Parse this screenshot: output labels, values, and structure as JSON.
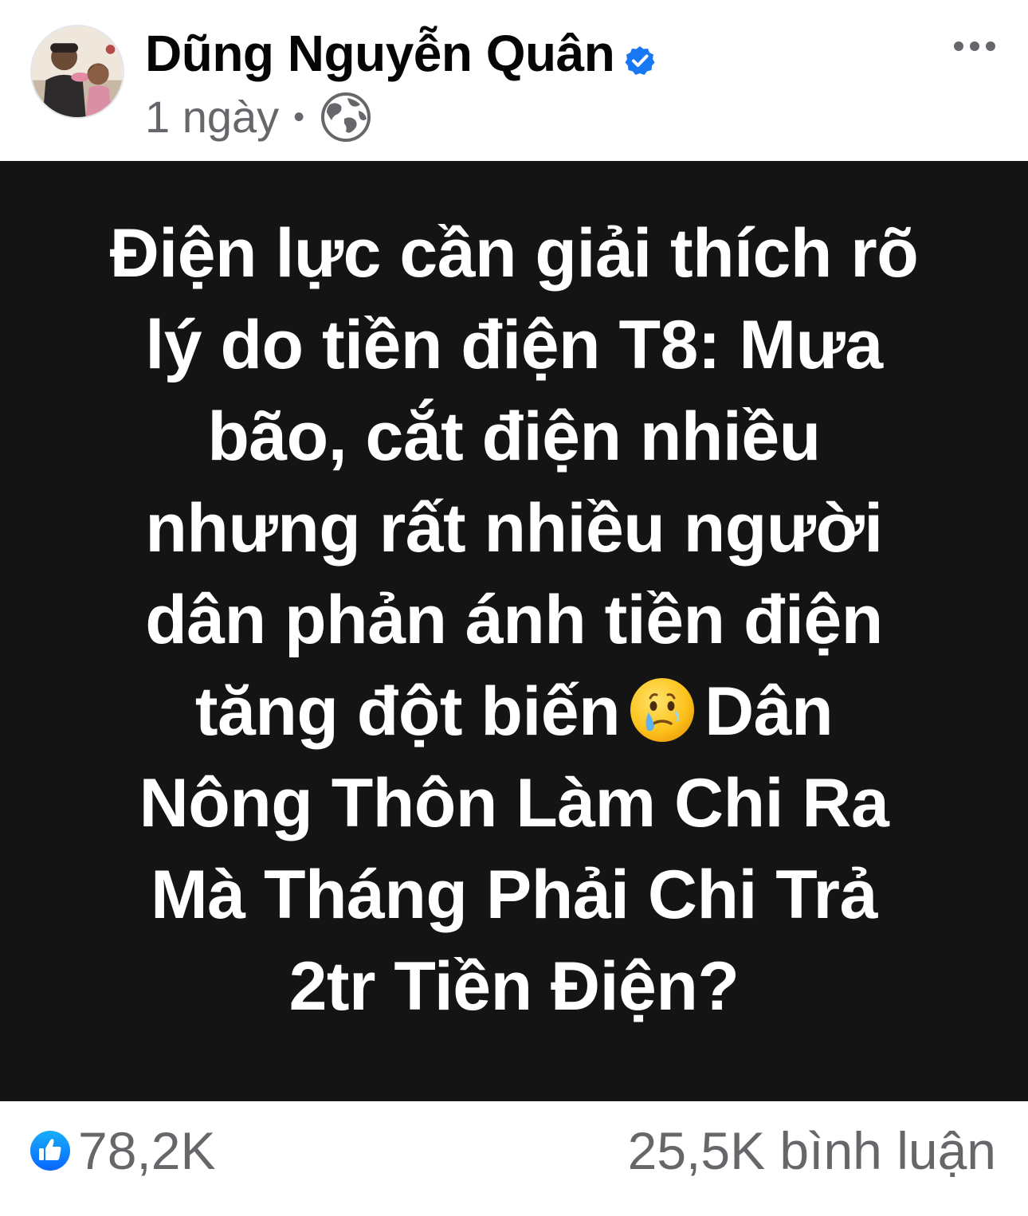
{
  "header": {
    "author_name": "Dũng Nguyễn Quân",
    "time_text": "1 ngày",
    "separator": "•",
    "audience_icon": "globe-icon",
    "verified_icon": "verified-badge-icon",
    "more_icon": "more-horizontal-icon"
  },
  "post": {
    "background_color": "#141414",
    "text_color": "#ffffff",
    "lines": [
      "Điện lực cần giải thích rõ",
      "lý do tiền điện T8: Mưa",
      "bão, cắt điện nhiều",
      "nhưng rất nhiều người",
      "dân phản ánh tiền điện",
      "tăng đột biến",
      "Dân",
      "Nông Thôn Làm Chi Ra",
      "Mà Tháng Phải Chi Trả",
      "2tr Tiền Điện?"
    ],
    "emoji": "face-holding-back-tears-emoji"
  },
  "footer": {
    "reaction_icon": "like-icon",
    "reaction_count": "78,2K",
    "comments_text": "25,5K bình luận"
  },
  "colors": {
    "verified_blue": "#1877f2",
    "secondary_text": "#65676b",
    "primary_text": "#050505"
  }
}
